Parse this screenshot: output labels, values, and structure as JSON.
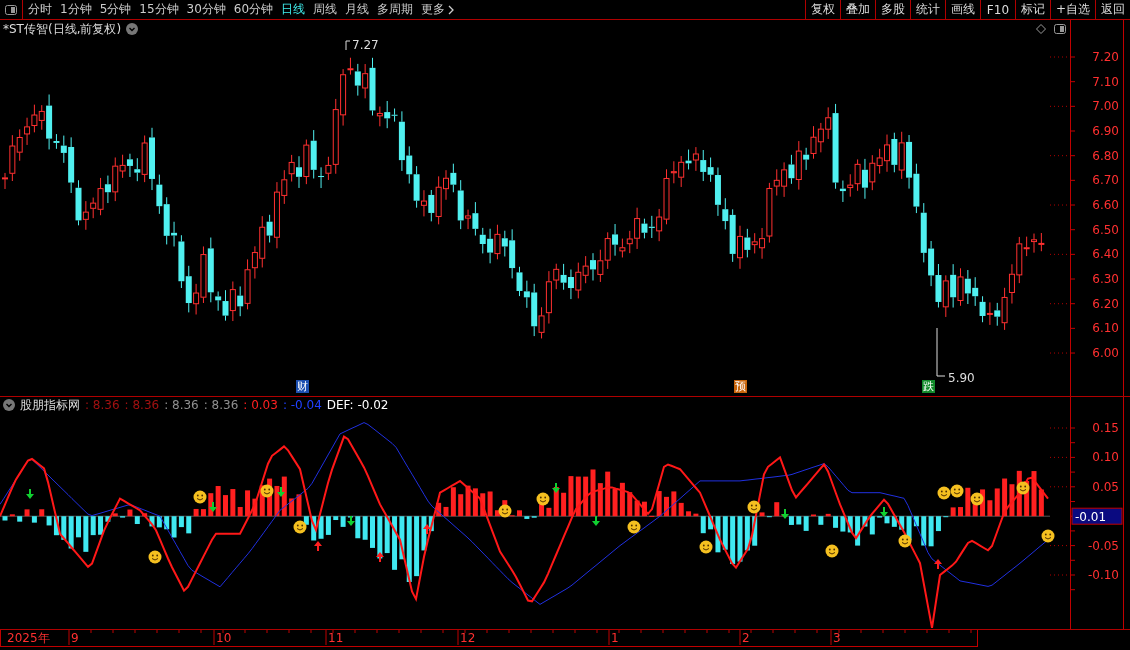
{
  "toolbar": {
    "periods": [
      {
        "label": "分时",
        "selected": false
      },
      {
        "label": "1分钟",
        "selected": false
      },
      {
        "label": "5分钟",
        "selected": false
      },
      {
        "label": "15分钟",
        "selected": false
      },
      {
        "label": "30分钟",
        "selected": false
      },
      {
        "label": "60分钟",
        "selected": false
      },
      {
        "label": "日线",
        "selected": true
      },
      {
        "label": "周线",
        "selected": false
      },
      {
        "label": "月线",
        "selected": false
      },
      {
        "label": "多周期",
        "selected": false
      },
      {
        "label": "更多",
        "selected": false
      }
    ],
    "buttons": [
      "复权",
      "叠加",
      "多股",
      "统计",
      "画线",
      "F10",
      "标记",
      "+自选",
      "返回"
    ]
  },
  "price_chart": {
    "title": "*ST传智(日线,前复权)",
    "high_label": "7.27",
    "low_label": "5.90",
    "events": [
      {
        "label": "财",
        "color": "#1c4fb0"
      },
      {
        "label": "预",
        "color": "#c8640a"
      },
      {
        "label": "跌",
        "color": "#128a2a"
      }
    ],
    "y_axis": [
      "7.20",
      "7.10",
      "7.00",
      "6.90",
      "6.80",
      "6.70",
      "6.60",
      "6.50",
      "6.40",
      "6.30",
      "6.20",
      "6.10",
      "6.00"
    ]
  },
  "indicator": {
    "name": "股朋指标网",
    "readings": [
      {
        "text": ": 8.36",
        "color": "#a01010"
      },
      {
        "text": ": 8.36",
        "color": "#a01010"
      },
      {
        "text": ": 8.36",
        "color": "#909090"
      },
      {
        "text": ": 8.36",
        "color": "#909090"
      },
      {
        "text": ": 0.03",
        "color": "#ff2020"
      },
      {
        "text": ": -0.04",
        "color": "#2040ff"
      }
    ],
    "def": "DEF: -0.02",
    "y_axis": [
      "0.15",
      "0.10",
      "0.05",
      "-0.05",
      "-0.10"
    ],
    "current": "-0.01"
  },
  "time_axis": [
    "2025年",
    "9",
    "10",
    "11",
    "12",
    "1",
    "2",
    "3"
  ]
}
